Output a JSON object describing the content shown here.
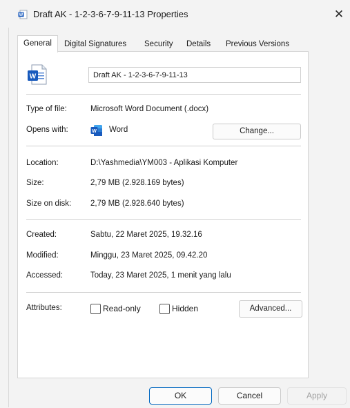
{
  "window": {
    "title": "Draft AK - 1-2-3-6-7-9-11-13 Properties",
    "close_glyph": "✕"
  },
  "tabs": [
    {
      "label": "General",
      "active": true
    },
    {
      "label": "Digital Signatures"
    },
    {
      "label": "Security"
    },
    {
      "label": "Details"
    },
    {
      "label": "Previous Versions"
    }
  ],
  "general": {
    "file_icon_letter": "W",
    "file_name": "Draft AK - 1-2-3-6-7-9-11-13",
    "type_label": "Type of file:",
    "type_value": "Microsoft Word Document (.docx)",
    "opens_label": "Opens with:",
    "opens_icon_letter": "W",
    "opens_value": "Word",
    "change_button": "Change...",
    "location_label": "Location:",
    "location_value": "D:\\Yashmedia\\YM003 - Aplikasi Komputer",
    "size_label": "Size:",
    "size_value": "2,79 MB (2.928.169 bytes)",
    "size_disk_label": "Size on disk:",
    "size_disk_value": "2,79 MB (2.928.640 bytes)",
    "created_label": "Created:",
    "created_value": "Sabtu, 22 Maret 2025, 19.32.16",
    "modified_label": "Modified:",
    "modified_value": "Minggu, 23 Maret 2025, 09.42.20",
    "accessed_label": "Accessed:",
    "accessed_value": "Today, 23 Maret 2025, 1 menit yang lalu",
    "attributes_label": "Attributes:",
    "readonly_label": "Read-only",
    "hidden_label": "Hidden",
    "advanced_button": "Advanced..."
  },
  "footer": {
    "ok": "OK",
    "cancel": "Cancel",
    "apply": "Apply"
  },
  "colors": {
    "word_blue": "#185abd",
    "ok_border": "#0067c0",
    "disabled_text": "#a0a0a0"
  }
}
